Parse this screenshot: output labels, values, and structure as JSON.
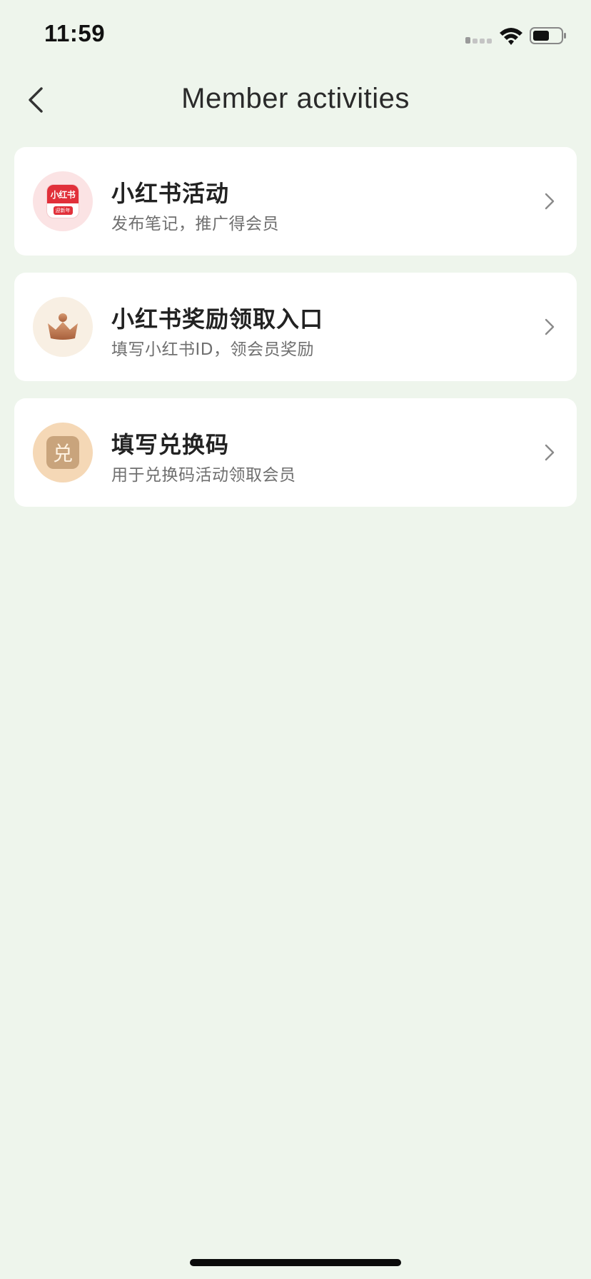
{
  "status": {
    "time": "11:59"
  },
  "nav": {
    "title": "Member activities"
  },
  "items": [
    {
      "title": "小红书活动",
      "subtitle": "发布笔记，推广得会员",
      "icon": "xiaohongshu-logo-icon",
      "logo_text": "小红书",
      "logo_badge": "迎新年"
    },
    {
      "title": "小红书奖励领取入口",
      "subtitle": "填写小红书ID，领会员奖励",
      "icon": "crown-icon"
    },
    {
      "title": "填写兑换码",
      "subtitle": "用于兑换码活动领取会员",
      "icon": "redeem-code-icon",
      "glyph": "兑"
    }
  ],
  "colors": {
    "background": "#eef5ec",
    "card": "#ffffff",
    "xhs_red": "#e1303a",
    "crown_bronze": "#b8734e",
    "redeem_tan": "#c9a47c"
  }
}
